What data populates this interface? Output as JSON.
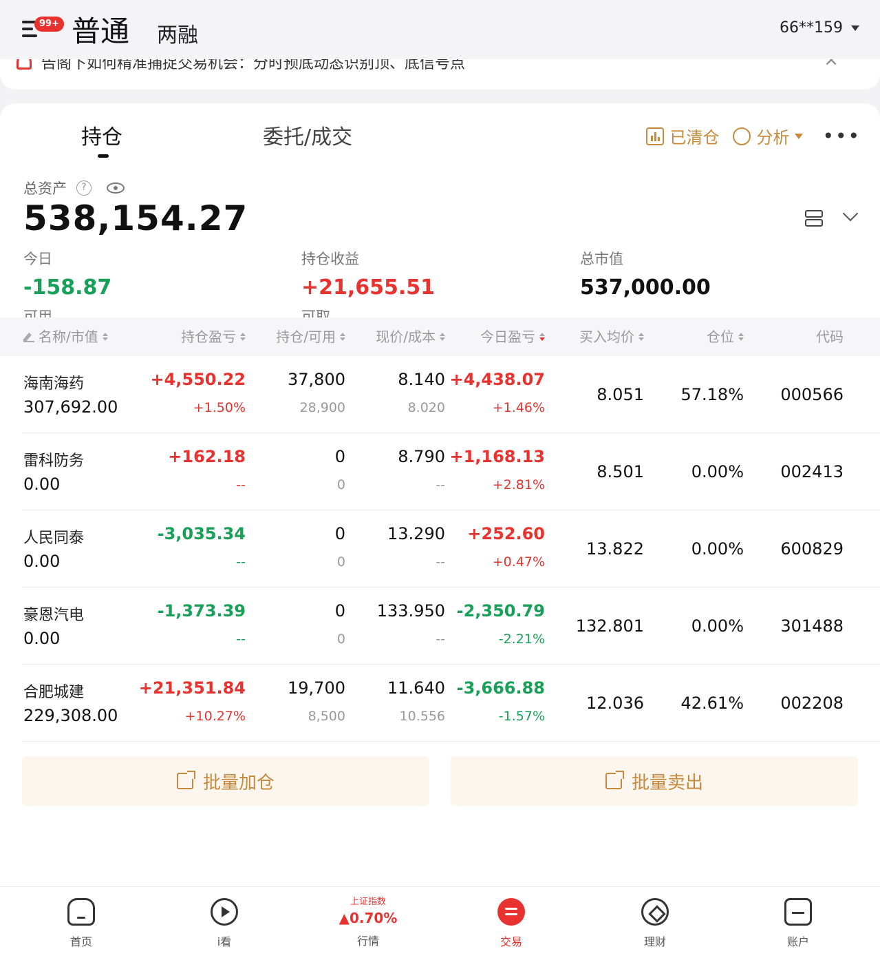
{
  "header": {
    "badge": "99+",
    "tab_main": "普通",
    "tab_secondary": "两融",
    "account": "66**159"
  },
  "notice": {
    "text": "告阁下如何精准捕捉交易机会：分时预底动态识别顶、底信号点",
    "close": "×"
  },
  "tabs": {
    "holdings": "持仓",
    "orders": "委托/成交",
    "cleared": "已清仓",
    "analysis": "分析",
    "more": "•••"
  },
  "summary": {
    "total_assets_label": "总资产",
    "total_assets": "538,154.27",
    "today_label": "今日",
    "today_value": "-158.87",
    "holding_pl_label": "持仓收益",
    "holding_pl_value": "+21,655.51",
    "market_value_label": "总市值",
    "market_value": "537,000.00",
    "hidden_label_1": "可用",
    "hidden_label_2": "可取"
  },
  "table": {
    "headers": [
      "名称/市值",
      "持仓盈亏",
      "持仓/可用",
      "现价/成本",
      "今日盈亏",
      "买入均价",
      "仓位",
      "代码"
    ],
    "rows": [
      {
        "name": "海南海药",
        "market_value": "307,692.00",
        "pl": "+4,550.22",
        "pl_pct": "+1.50%",
        "hold": "37,800",
        "avail": "28,900",
        "price": "8.140",
        "cost": "8.020",
        "today_pl": "+4,438.07",
        "today_pct": "+1.46%",
        "avg": "8.051",
        "position": "57.18%",
        "code": "000566",
        "pl_color": "red",
        "today_color": "red"
      },
      {
        "name": "雷科防务",
        "market_value": "0.00",
        "pl": "+162.18",
        "pl_pct": "--",
        "hold": "0",
        "avail": "0",
        "price": "8.790",
        "cost": "--",
        "today_pl": "+1,168.13",
        "today_pct": "+2.81%",
        "avg": "8.501",
        "position": "0.00%",
        "code": "002413",
        "pl_color": "red",
        "today_color": "red"
      },
      {
        "name": "人民同泰",
        "market_value": "0.00",
        "pl": "-3,035.34",
        "pl_pct": "--",
        "hold": "0",
        "avail": "0",
        "price": "13.290",
        "cost": "--",
        "today_pl": "+252.60",
        "today_pct": "+0.47%",
        "avg": "13.822",
        "position": "0.00%",
        "code": "600829",
        "pl_color": "green",
        "today_color": "red"
      },
      {
        "name": "豪恩汽电",
        "market_value": "0.00",
        "pl": "-1,373.39",
        "pl_pct": "--",
        "hold": "0",
        "avail": "0",
        "price": "133.950",
        "cost": "--",
        "today_pl": "-2,350.79",
        "today_pct": "-2.21%",
        "avg": "132.801",
        "position": "0.00%",
        "code": "301488",
        "pl_color": "green",
        "today_color": "green"
      },
      {
        "name": "合肥城建",
        "market_value": "229,308.00",
        "pl": "+21,351.84",
        "pl_pct": "+10.27%",
        "hold": "19,700",
        "avail": "8,500",
        "price": "11.640",
        "cost": "10.556",
        "today_pl": "-3,666.88",
        "today_pct": "-1.57%",
        "avg": "12.036",
        "position": "42.61%",
        "code": "002208",
        "pl_color": "red",
        "today_color": "green"
      }
    ]
  },
  "actions": {
    "batch_add": "批量加仓",
    "batch_sell": "批量卖出"
  },
  "nav": {
    "home": "首页",
    "watch": "i看",
    "market_index_name": "上证指数",
    "market_index_value": "▲0.70%",
    "market": "行情",
    "trade": "交易",
    "finance": "理财",
    "account": "账户"
  },
  "colors": {
    "up": "#e8322f",
    "down": "#18a058",
    "accent": "#c78a3c"
  }
}
